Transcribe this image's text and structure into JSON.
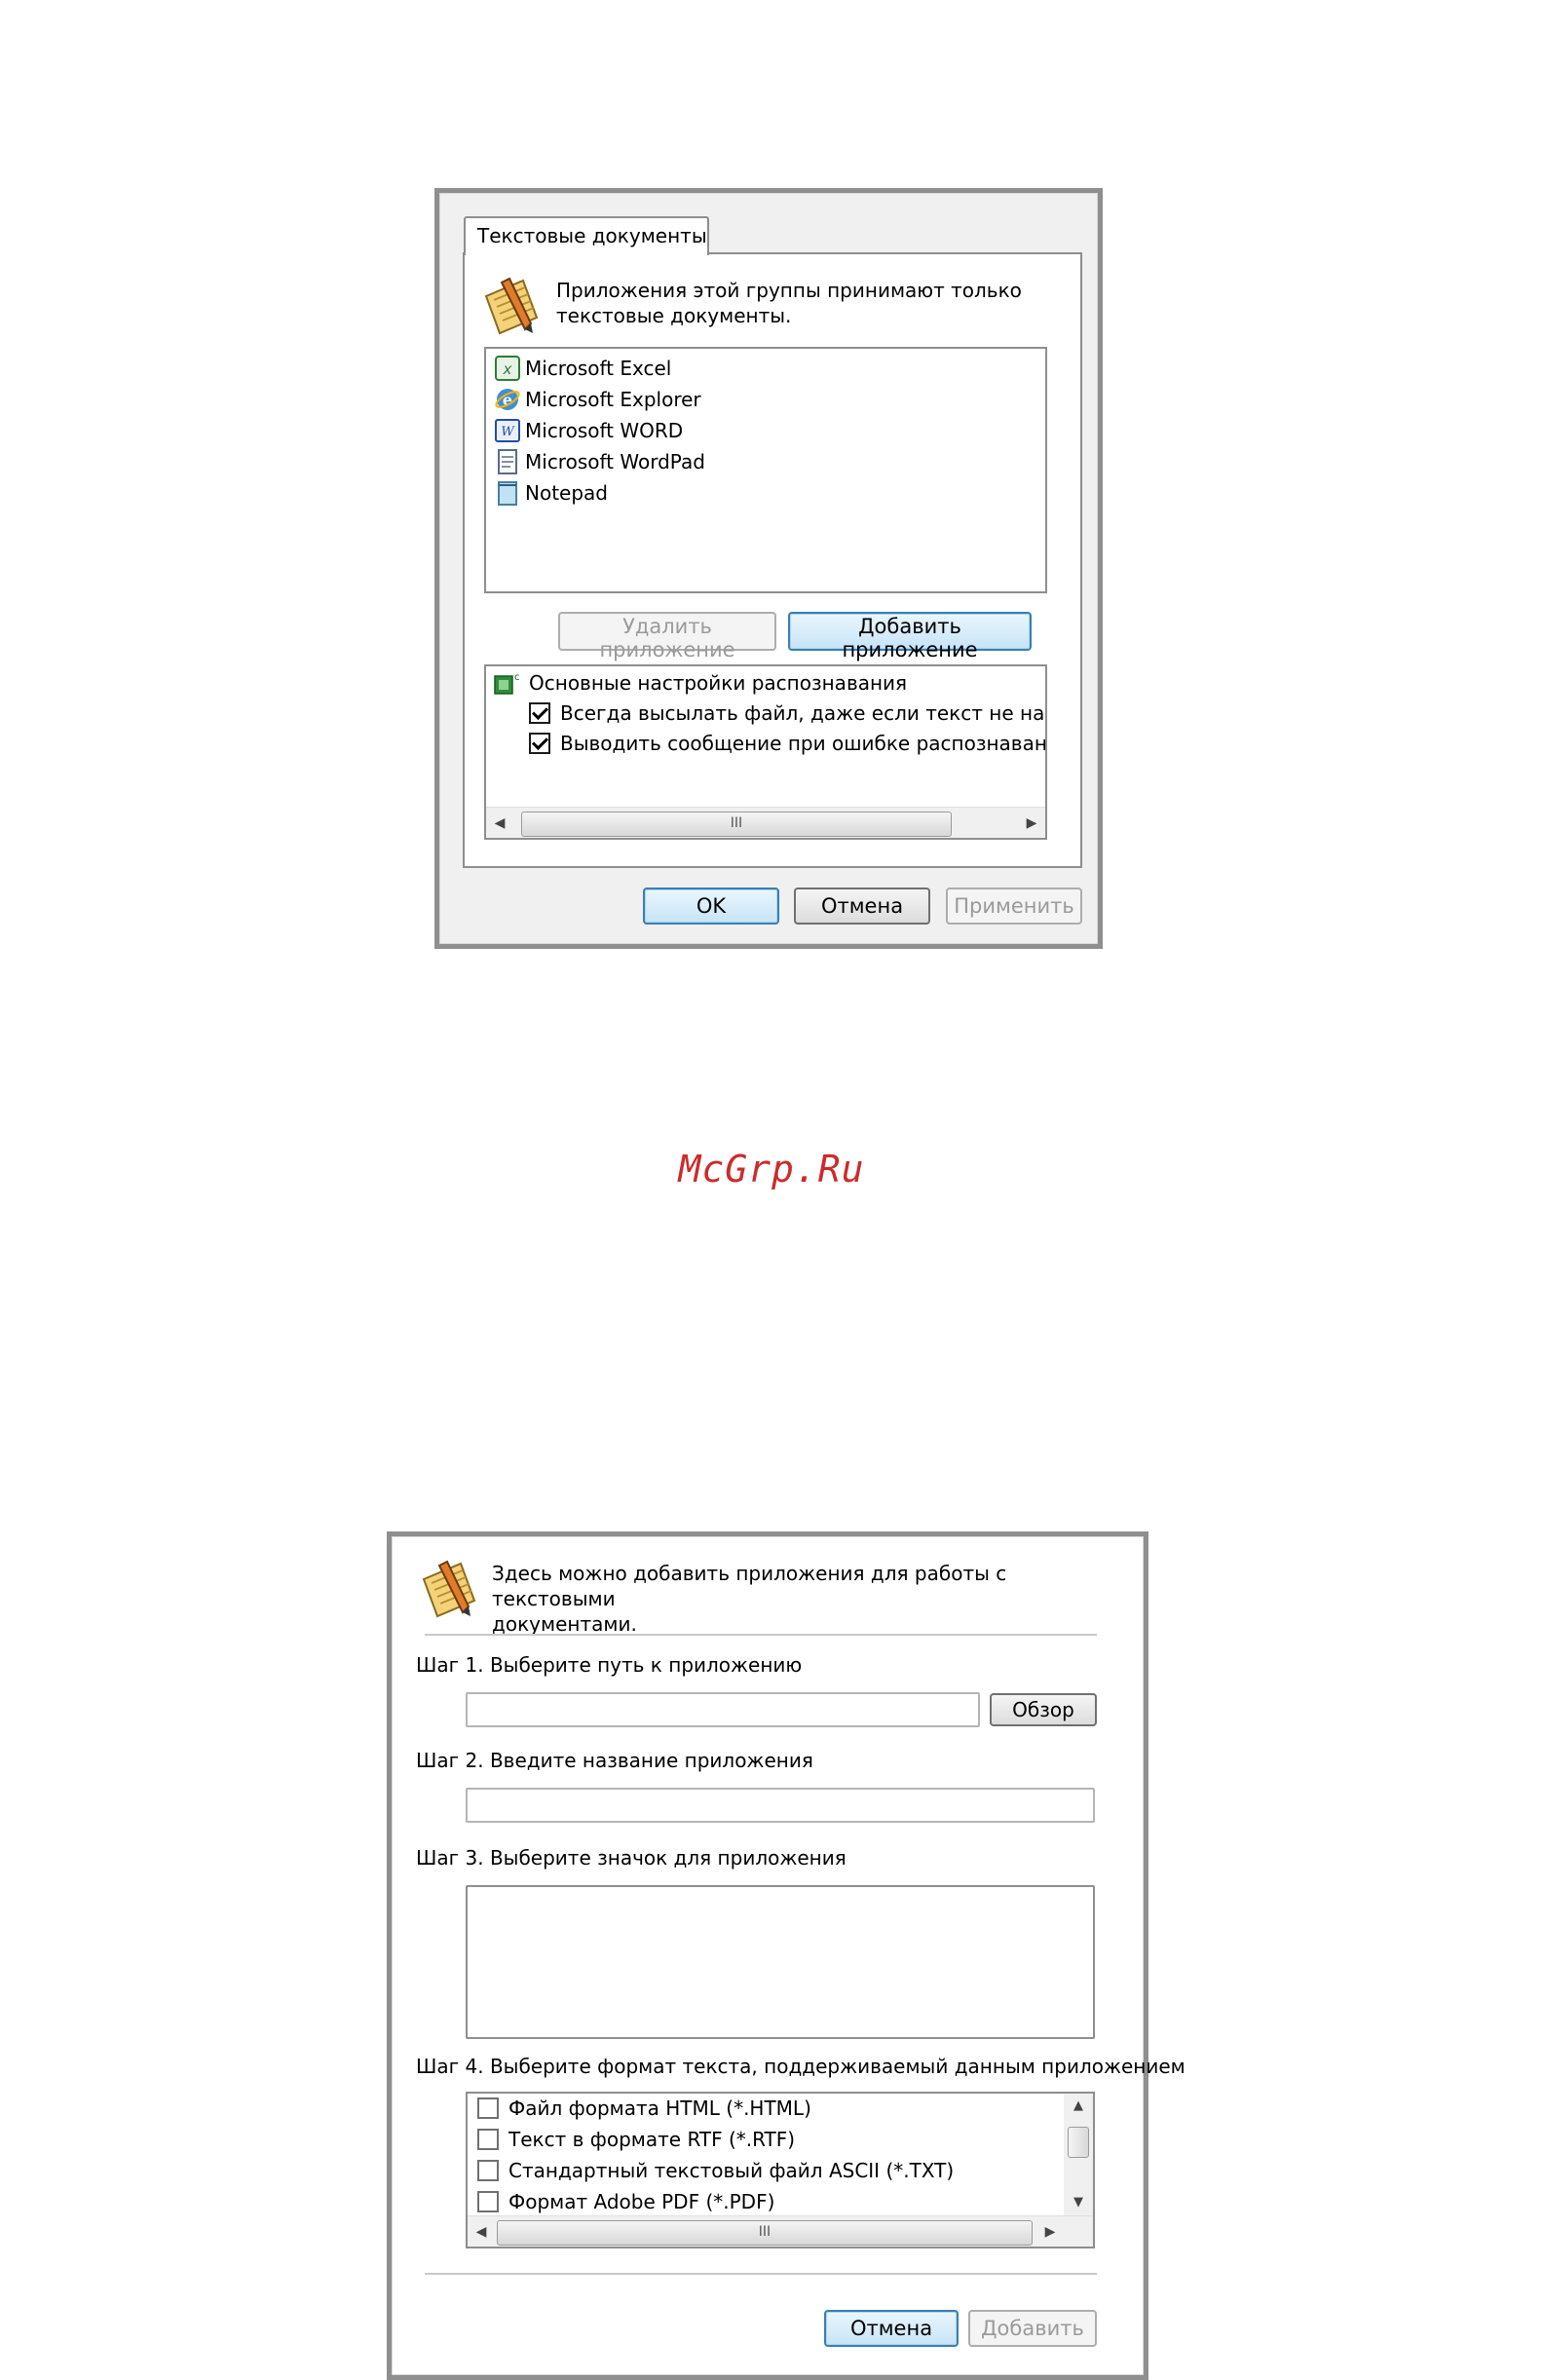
{
  "dialog1": {
    "tab_label": "Текстовые документы",
    "description_line1": "Приложения этой группы принимают только",
    "description_line2": "текстовые документы.",
    "apps": [
      {
        "label": "Microsoft Excel",
        "icon": "excel-icon"
      },
      {
        "label": "Microsoft Explorer",
        "icon": "explorer-icon"
      },
      {
        "label": "Microsoft WORD",
        "icon": "word-icon"
      },
      {
        "label": "Microsoft WordPad",
        "icon": "wordpad-icon"
      },
      {
        "label": "Notepad",
        "icon": "notepad-icon"
      }
    ],
    "remove_app_label": "Удалить приложение",
    "add_app_label": "Добавить приложение",
    "settings": {
      "root_label": "Основные настройки распознавания",
      "options": [
        {
          "label": "Всегда высылать файл, даже если текст не найд",
          "checked": true
        },
        {
          "label": "Выводить сообщение при ошибке распознавания",
          "checked": true
        }
      ],
      "scroll_grip": "III"
    },
    "ok_label": "OK",
    "cancel_label": "Отмена",
    "apply_label": "Применить"
  },
  "watermark": "McGrp.Ru",
  "dialog2": {
    "description_line1": "Здесь можно добавить приложения для работы с текстовыми",
    "description_line2": "документами.",
    "step1_label": "Шаг 1. Выберите путь к приложению",
    "browse_label": "Обзор",
    "step2_label": "Шаг 2. Введите название приложения",
    "step3_label": "Шаг 3. Выберите значок для приложения",
    "step4_label": "Шаг 4. Выберите формат текста, поддерживаемый данным приложением",
    "formats": [
      {
        "label": "Файл формата HTML (*.HTML)",
        "checked": false
      },
      {
        "label": "Текст в формате RTF (*.RTF)",
        "checked": false
      },
      {
        "label": "Стандартный текстовый файл ASCII (*.TXT)",
        "checked": false
      },
      {
        "label": "Формат Adobe PDF (*.PDF)",
        "checked": false
      }
    ],
    "scroll_grip": "III",
    "cancel_label": "Отмена",
    "add_label": "Добавить"
  }
}
